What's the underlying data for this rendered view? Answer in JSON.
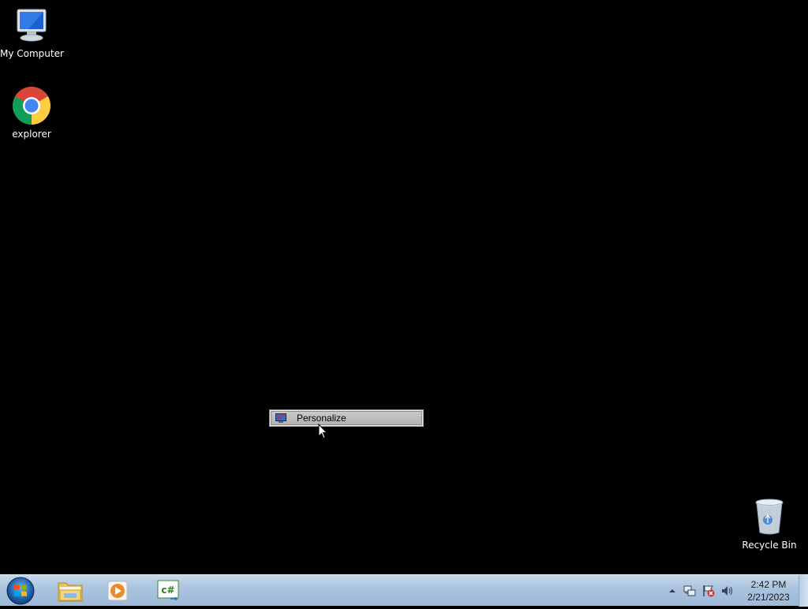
{
  "desktop": {
    "icons": [
      {
        "label": "My Computer",
        "icon": "computer-icon"
      },
      {
        "label": "explorer",
        "icon": "chrome-icon"
      },
      {
        "label": "Recycle Bin",
        "icon": "recycle-bin-icon"
      }
    ]
  },
  "context_menu": {
    "items": [
      {
        "label": "Personalize",
        "icon": "personalize-icon"
      }
    ]
  },
  "taskbar": {
    "start_icon": "windows-start-icon",
    "pinned": [
      {
        "name": "Windows Explorer",
        "icon": "folder-icon"
      },
      {
        "name": "Windows Media Player",
        "icon": "media-player-icon"
      },
      {
        "name": "C#",
        "icon": "csharp-icon",
        "badge": "c#"
      }
    ],
    "tray": {
      "icons": [
        "show-hidden-icons-icon",
        "network-icon",
        "action-center-icon",
        "volume-icon"
      ]
    },
    "clock": {
      "time": "2:42 PM",
      "date": "2/21/2023"
    }
  },
  "colors": {
    "desktop_bg": "#000000",
    "taskbar_top": "#c7d8eb",
    "taskbar_bottom": "#9db9d8",
    "menu_highlight": "#b8b8b8"
  }
}
